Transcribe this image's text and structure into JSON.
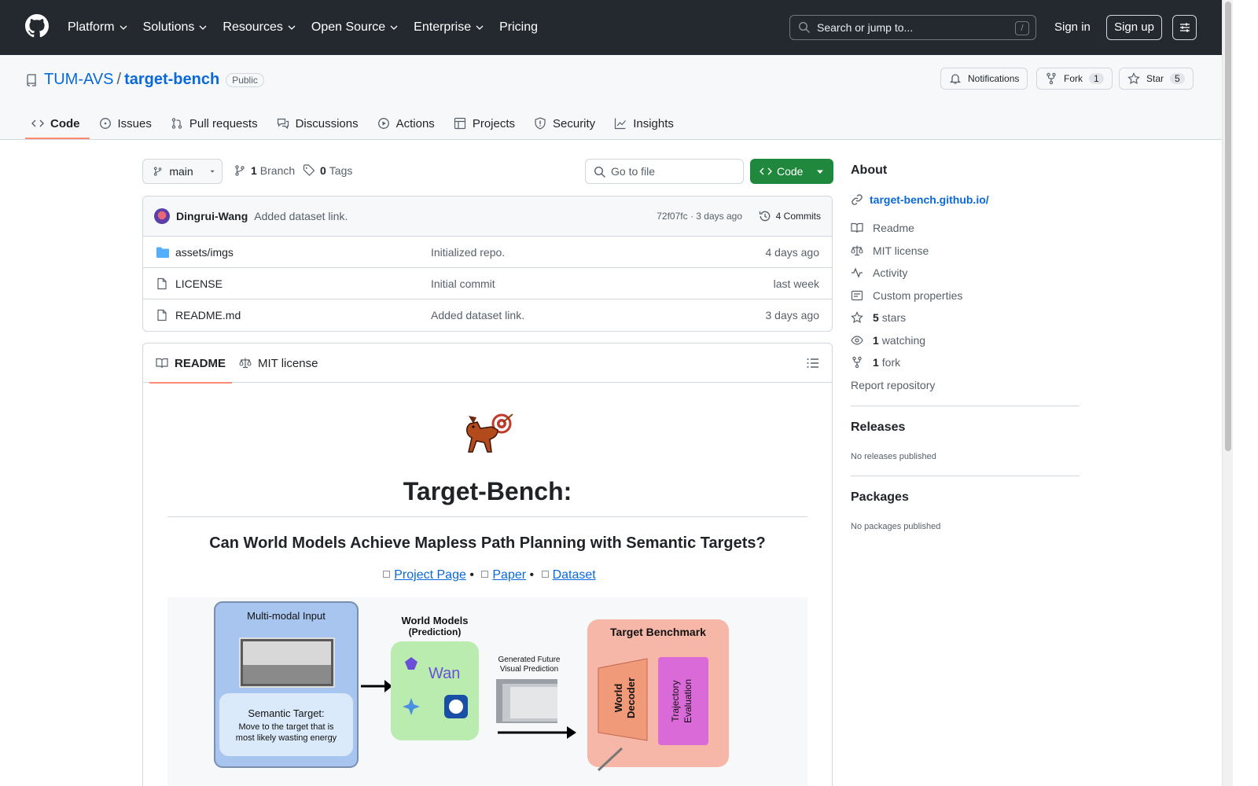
{
  "header": {
    "nav": [
      "Platform",
      "Solutions",
      "Resources",
      "Open Source",
      "Enterprise",
      "Pricing"
    ],
    "search_placeholder": "Search or jump to...",
    "search_kbd": "/",
    "sign_in": "Sign in",
    "sign_up": "Sign up"
  },
  "repo": {
    "owner": "TUM-AVS",
    "separator": "/",
    "name": "target-bench",
    "visibility": "Public",
    "notifications": "Notifications",
    "fork_label": "Fork",
    "fork_count": "1",
    "star_label": "Star",
    "star_count": "5"
  },
  "tabs": [
    "Code",
    "Issues",
    "Pull requests",
    "Discussions",
    "Actions",
    "Projects",
    "Security",
    "Insights"
  ],
  "browser": {
    "branch": "main",
    "branches_count": "1",
    "branches_label": "Branch",
    "tags_count": "0",
    "tags_label": "Tags",
    "goto_placeholder": "Go to file",
    "code_button": "Code"
  },
  "commit": {
    "author": "Dingrui-Wang",
    "message": "Added dataset link.",
    "sha_time": "72f07fc · 3 days ago",
    "commits": "4 Commits"
  },
  "files": [
    {
      "name": "assets/imgs",
      "type": "folder",
      "message": "Initialized repo.",
      "date": "4 days ago"
    },
    {
      "name": "LICENSE",
      "type": "file",
      "message": "Initial commit",
      "date": "last week"
    },
    {
      "name": "README.md",
      "type": "file",
      "message": "Added dataset link.",
      "date": "3 days ago"
    }
  ],
  "readme": {
    "tab_readme": "README",
    "tab_license": "MIT license",
    "title": "Target-Bench:",
    "subtitle": "Can World Models Achieve Mapless Path Planning with Semantic Targets?",
    "links": [
      "Project Page",
      "Paper",
      "Dataset"
    ],
    "separator": "•",
    "diagram": {
      "input_title": "Multi-modal Input",
      "semantic_title": "Semantic Target:",
      "semantic_text_1": "Move to the target that is",
      "semantic_text_2": "most likely wasting energy",
      "wm_title": "World Models",
      "wm_sub": "(Prediction)",
      "wan": "Wan",
      "gen_1": "Generated Future",
      "gen_2": "Visual Prediction",
      "bench_title": "Target Benchmark",
      "decoder_1": "World",
      "decoder_2": "Decoder",
      "traj_1": "Trajectory",
      "traj_2": "Evaluation"
    }
  },
  "sidebar": {
    "about": "About",
    "website": "target-bench.github.io/",
    "items": [
      {
        "icon": "book-icon",
        "label": "Readme"
      },
      {
        "icon": "law-icon",
        "label": "MIT license"
      },
      {
        "icon": "pulse-icon",
        "label": "Activity"
      },
      {
        "icon": "note-icon",
        "label": "Custom properties"
      }
    ],
    "stars_count": "5",
    "stars_label": "stars",
    "watching_count": "1",
    "watching_label": "watching",
    "forks_count": "1",
    "forks_label": "fork",
    "report": "Report repository",
    "releases_title": "Releases",
    "releases_note": "No releases published",
    "packages_title": "Packages",
    "packages_note": "No packages published"
  },
  "colors": {
    "header_bg": "#24292f",
    "link": "#0969da",
    "code_button": "#1f883d",
    "tab_underline": "#fd8c73"
  }
}
